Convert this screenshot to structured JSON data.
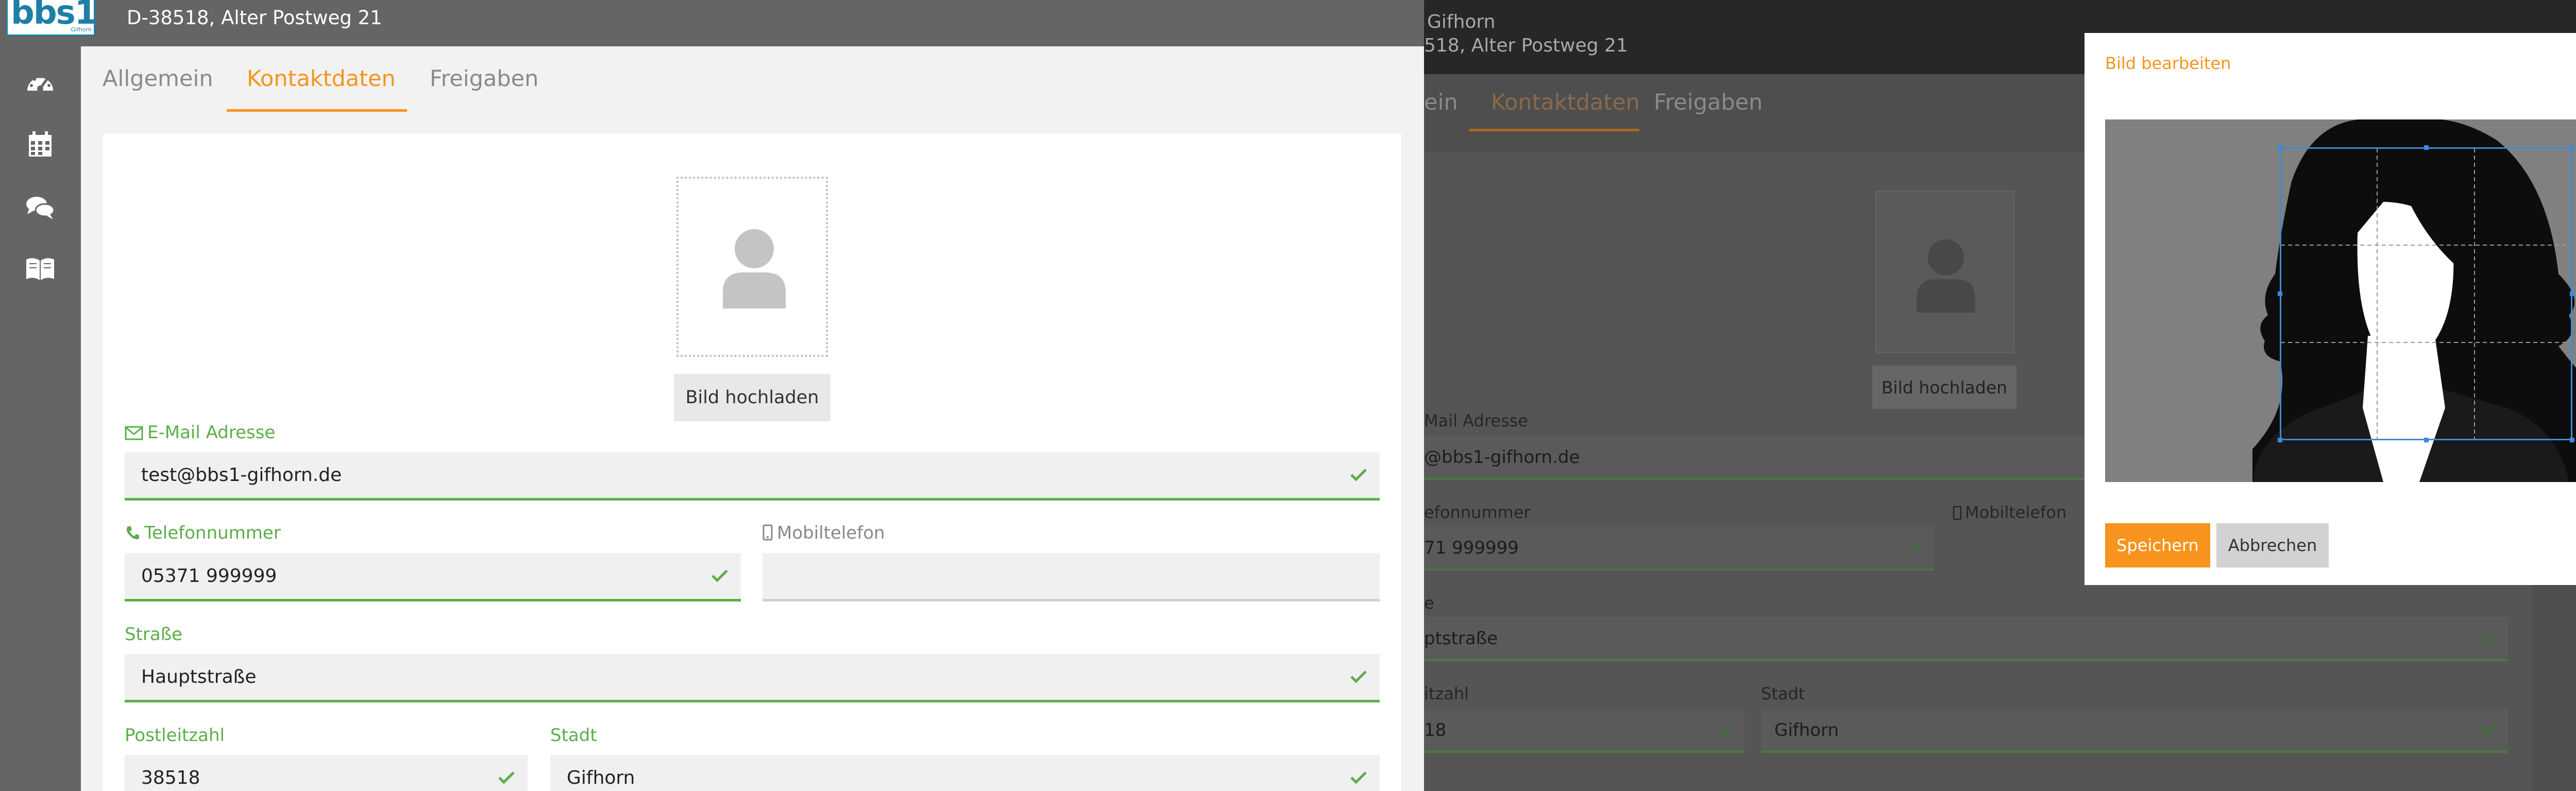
{
  "header": {
    "logo_text": "bbs1",
    "logo_sub": "Gifhorn",
    "address": "D-38518, Alter Postweg 21"
  },
  "sidebar": {
    "items": [
      {
        "icon": "dashboard-icon"
      },
      {
        "icon": "calendar-icon"
      },
      {
        "icon": "chat-icon"
      },
      {
        "icon": "book-icon"
      }
    ]
  },
  "tabs": [
    {
      "label": "Allgemein",
      "active": false
    },
    {
      "label": "Kontaktdaten",
      "active": true
    },
    {
      "label": "Freigaben",
      "active": false
    }
  ],
  "form": {
    "upload_label": "Bild hochladen",
    "email": {
      "label": "E-Mail Adresse",
      "value": "test@bbs1-gifhorn.de"
    },
    "phone": {
      "label": "Telefonnummer",
      "value": "05371 999999"
    },
    "mobile": {
      "label": "Mobiltelefon",
      "value": ""
    },
    "street": {
      "label": "Straße",
      "value": "Hauptstraße"
    },
    "zip": {
      "label": "Postleitzahl",
      "value": "38518"
    },
    "city": {
      "label": "Stadt",
      "value": "Gifhorn"
    }
  },
  "background_panel": {
    "name": "Gifhorn",
    "address": "518, Alter Postweg 21",
    "tabs": [
      "ein",
      "Kontaktdaten",
      "Freigaben"
    ],
    "upload_label": "Bild hochladen",
    "email_label": "Mail Adresse",
    "email_value": "@bbs1-gifhorn.de",
    "phone_label": "efonnummer",
    "phone_value": "71 999999",
    "mobile_label": "Mobiltelefon",
    "street_label": "e",
    "street_value": "ptstraße",
    "zip_label": "itzahl",
    "zip_value": "18",
    "city_label": "Stadt",
    "city_value": "Gifhorn"
  },
  "dialog": {
    "title": "Bild bearbeiten",
    "save_label": "Speichern",
    "cancel_label": "Abbrechen"
  },
  "colors": {
    "accent": "#f7941d",
    "valid": "#5cae4a",
    "crop_border": "#3d8ad8",
    "brand": "#1e7fa6"
  }
}
